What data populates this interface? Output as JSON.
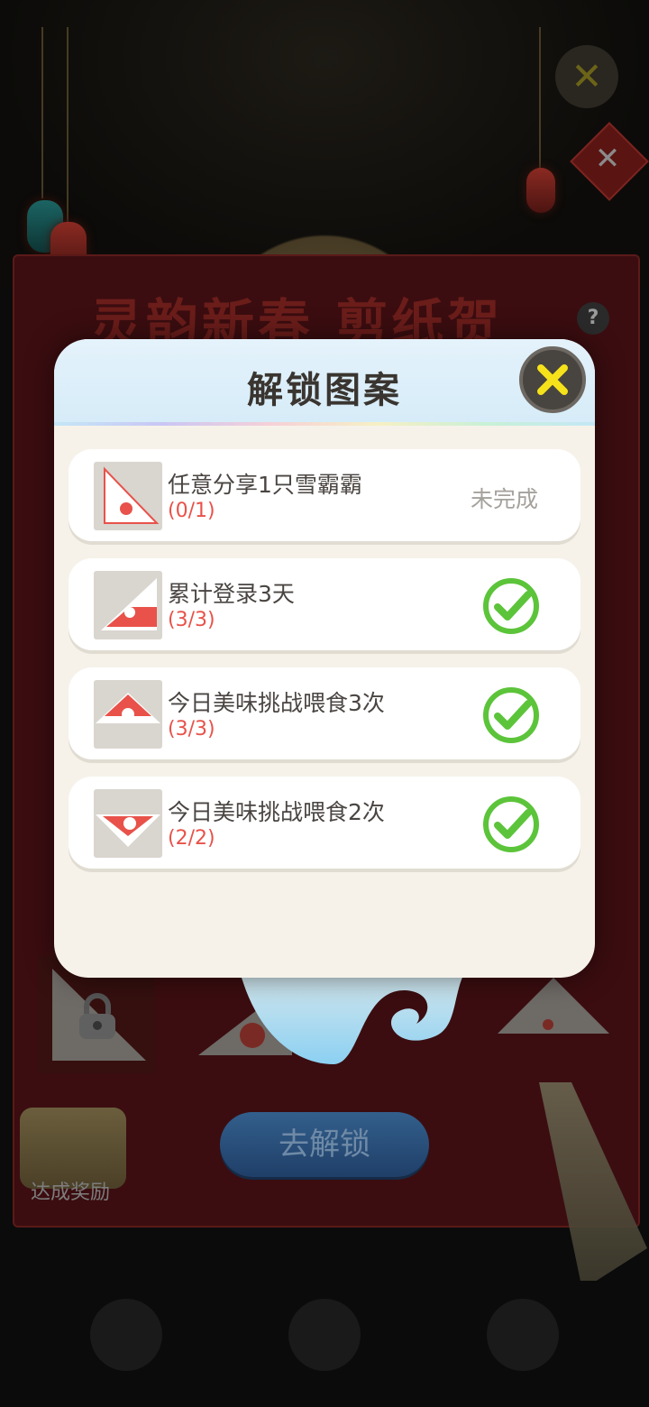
{
  "background": {
    "banner_title": "灵韵新春  剪纸贺岁",
    "help_icon": "question-icon",
    "unlock_button_label": "去解锁",
    "reward_label": "达成奖励"
  },
  "modal": {
    "title": "解锁图案",
    "close_icon": "close-icon",
    "tasks": [
      {
        "title": "任意分享1只雪霸霸",
        "progress": "(0/1)",
        "status": "未完成",
        "completed": false
      },
      {
        "title": "累计登录3天",
        "progress": "(3/3)",
        "completed": true
      },
      {
        "title": "今日美味挑战喂食3次",
        "progress": "(3/3)",
        "completed": true
      },
      {
        "title": "今日美味挑战喂食2次",
        "progress": "(2/2)",
        "completed": true
      }
    ]
  },
  "colors": {
    "accent_red": "#e8524a",
    "check_green": "#5cc43a",
    "close_yellow": "#f6e21a"
  }
}
